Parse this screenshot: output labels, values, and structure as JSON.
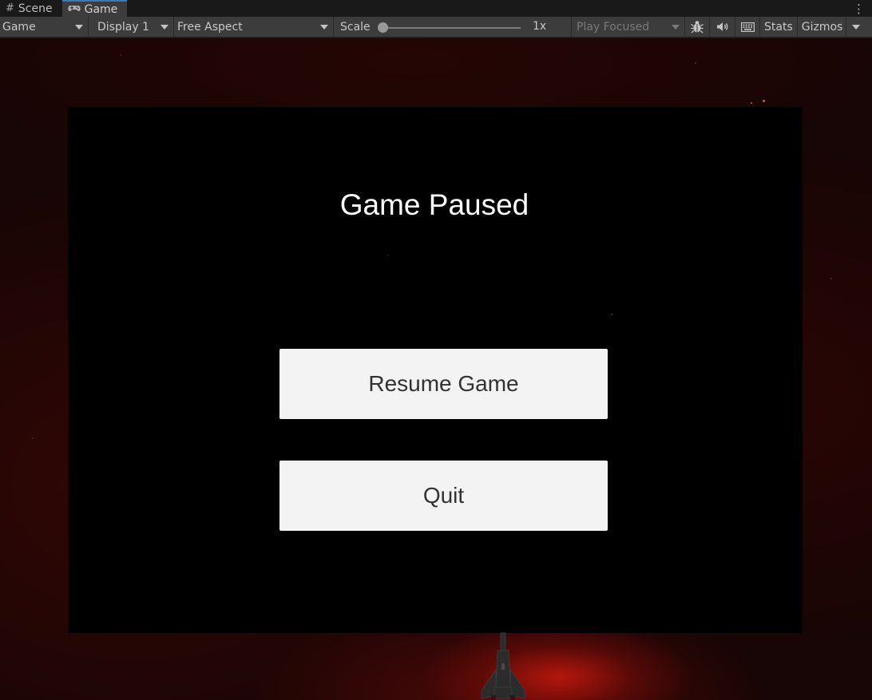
{
  "tabs": [
    {
      "label": "Scene",
      "icon": "grid-icon"
    },
    {
      "label": "Game",
      "icon": "gamepad-icon",
      "active": true
    }
  ],
  "toolbar": {
    "view_mode": "Game",
    "display": "Display 1",
    "aspect": "Free Aspect",
    "scale_label": "Scale",
    "scale_value": "1x",
    "play_mode": "Play Focused",
    "stats_label": "Stats",
    "gizmos_label": "Gizmos"
  },
  "game": {
    "title": "Game Paused",
    "resume_label": "Resume Game",
    "quit_label": "Quit"
  },
  "colors": {
    "toolbar_bg": "#3c3c3c",
    "tab_accent": "#3a79bb",
    "button_bg": "#f3f3f3",
    "panel_bg": "#000000",
    "nebula_red": "#c8190f"
  }
}
